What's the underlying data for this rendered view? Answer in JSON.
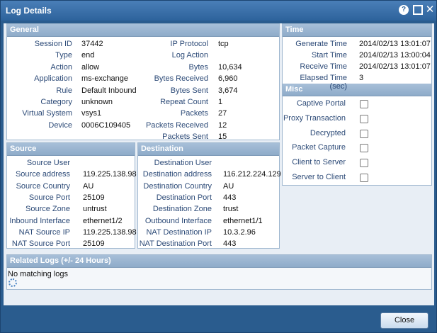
{
  "window": {
    "title": "Log Details",
    "help_icon": "?",
    "close_icon": "✕"
  },
  "general": {
    "header": "General",
    "left": [
      {
        "label": "Session ID",
        "value": "37442"
      },
      {
        "label": "Type",
        "value": "end"
      },
      {
        "label": "Action",
        "value": "allow"
      },
      {
        "label": "Application",
        "value": "ms-exchange"
      },
      {
        "label": "Rule",
        "value": "Default Inbound"
      },
      {
        "label": "Category",
        "value": "unknown"
      },
      {
        "label": "Virtual System",
        "value": "vsys1"
      },
      {
        "label": "Device",
        "value": "0006C109405"
      }
    ],
    "right": [
      {
        "label": "IP Protocol",
        "value": "tcp"
      },
      {
        "label": "Log Action",
        "value": ""
      },
      {
        "label": "Bytes",
        "value": "10,634"
      },
      {
        "label": "Bytes Received",
        "value": "6,960"
      },
      {
        "label": "Bytes Sent",
        "value": "3,674"
      },
      {
        "label": "Repeat Count",
        "value": "1"
      },
      {
        "label": "Packets",
        "value": "27"
      },
      {
        "label": "Packets Received",
        "value": "12"
      },
      {
        "label": "Packets Sent",
        "value": "15"
      }
    ]
  },
  "time": {
    "header": "Time",
    "rows": [
      {
        "label": "Generate Time",
        "value": "2014/02/13 13:01:07"
      },
      {
        "label": "Start Time",
        "value": "2014/02/13 13:00:04"
      },
      {
        "label": "Receive Time",
        "value": "2014/02/13 13:01:07"
      },
      {
        "label": "Elapsed Time (sec)",
        "value": "3"
      }
    ]
  },
  "misc": {
    "header": "Misc",
    "rows": [
      {
        "label": "Captive Portal",
        "checked": false
      },
      {
        "label": "Proxy Transaction",
        "checked": false
      },
      {
        "label": "Decrypted",
        "checked": false
      },
      {
        "label": "Packet Capture",
        "checked": false
      },
      {
        "label": "Client to Server",
        "checked": false
      },
      {
        "label": "Server to Client",
        "checked": false
      }
    ]
  },
  "source": {
    "header": "Source",
    "rows": [
      {
        "label": "Source User",
        "value": ""
      },
      {
        "label": "Source address",
        "value": "119.225.138.98"
      },
      {
        "label": "Source Country",
        "value": "AU"
      },
      {
        "label": "Source Port",
        "value": "25109"
      },
      {
        "label": "Source Zone",
        "value": "untrust"
      },
      {
        "label": "Inbound Interface",
        "value": "ethernet1/2"
      },
      {
        "label": "NAT Source IP",
        "value": "119.225.138.98"
      },
      {
        "label": "NAT Source Port",
        "value": "25109"
      }
    ]
  },
  "destination": {
    "header": "Destination",
    "rows": [
      {
        "label": "Destination User",
        "value": ""
      },
      {
        "label": "Destination address",
        "value": "116.212.224.129"
      },
      {
        "label": "Destination Country",
        "value": "AU"
      },
      {
        "label": "Destination Port",
        "value": "443"
      },
      {
        "label": "Destination Zone",
        "value": "trust"
      },
      {
        "label": "Outbound Interface",
        "value": "ethernet1/1"
      },
      {
        "label": "NAT Destination IP",
        "value": "10.3.2.96"
      },
      {
        "label": "NAT Destination Port",
        "value": "443"
      }
    ]
  },
  "related": {
    "header": "Related Logs (+/- 24 Hours)",
    "message": "No matching logs"
  },
  "footer": {
    "close_label": "Close"
  }
}
